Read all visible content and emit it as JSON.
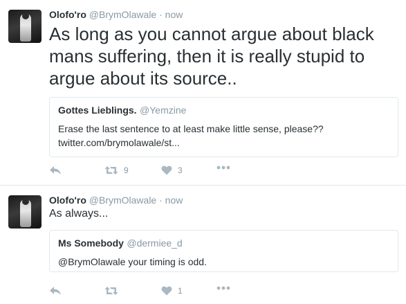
{
  "tweets": [
    {
      "name": "Olofo'ro",
      "handle": "@BrymOlawale",
      "separator": "·",
      "time": "now",
      "text": "As long as you cannot argue about black mans suffering, then it is really stupid to argue about its source..",
      "quote": {
        "name": "Gottes Lieblings.",
        "handle": "@Yemzine",
        "text": "Erase the last sentence to at least make little sense, please?? twitter.com/brymolawale/st..."
      },
      "actions": {
        "reply_icon": "reply-icon",
        "retweet_icon": "retweet-icon",
        "retweet_count": "9",
        "like_icon": "heart-icon",
        "like_count": "3",
        "more_icon": "more-icon"
      }
    },
    {
      "name": "Olofo'ro",
      "handle": "@BrymOlawale",
      "separator": "·",
      "time": "now",
      "text": "As always...",
      "quote": {
        "name": "Ms Somebody",
        "handle": "@dermiee_d",
        "text": "@BrymOlawale your timing is odd."
      },
      "actions": {
        "reply_icon": "reply-icon",
        "retweet_icon": "retweet-icon",
        "retweet_count": "",
        "like_icon": "heart-icon",
        "like_count": "1",
        "more_icon": "more-icon"
      }
    }
  ],
  "colors": {
    "text": "#292f33",
    "muted": "#8899a6",
    "icon": "#aab8c2",
    "border": "#e1e8ed"
  }
}
